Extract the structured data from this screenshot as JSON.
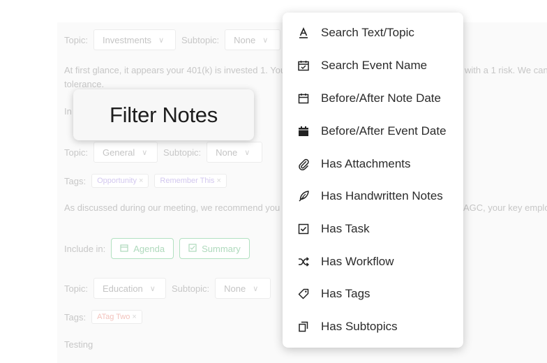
{
  "background": {
    "note1": {
      "topic_label": "Topic:",
      "topic_value": "Investments",
      "subtopic_label": "Subtopic:",
      "subtopic_value": "None",
      "body_line1_left": "At first glance, it appears your 401(k) is invested 1. You h",
      "body_line1_right": "with a 1 risk. We can",
      "body_line2": "tolerance.",
      "include_fragment": "In"
    },
    "note2": {
      "topic_label": "Topic:",
      "topic_value": "General",
      "subtopic_label": "Subtopic:",
      "subtopic_value": "None",
      "tags_label": "Tags:",
      "tags": [
        "Opportunity",
        "Remember This"
      ],
      "body_left": "As discussed during our meeting, we recommend you co",
      "body_right": "AGC, your key employ",
      "include_label": "Include in:",
      "include_chips": [
        "Agenda",
        "Summary"
      ]
    },
    "note3": {
      "topic_label": "Topic:",
      "topic_value": "Education",
      "subtopic_label": "Subtopic:",
      "subtopic_value": "None",
      "tags_label": "Tags:",
      "tags": [
        "ATag Two"
      ],
      "body": "Testing"
    },
    "tag_close_glyph": "×",
    "chevron_glyph": "∨"
  },
  "filter_title": "Filter Notes",
  "menu": {
    "items": [
      {
        "label": "Search Text/Topic",
        "icon": "text-a-icon"
      },
      {
        "label": "Search Event Name",
        "icon": "calendar-check-icon"
      },
      {
        "label": "Before/After Note Date",
        "icon": "calendar-outline-icon"
      },
      {
        "label": "Before/After Event Date",
        "icon": "calendar-filled-icon"
      },
      {
        "label": "Has Attachments",
        "icon": "paperclip-icon"
      },
      {
        "label": "Has Handwritten Notes",
        "icon": "quill-icon"
      },
      {
        "label": "Has Task",
        "icon": "checkbox-icon"
      },
      {
        "label": "Has Workflow",
        "icon": "shuffle-icon"
      },
      {
        "label": "Has Tags",
        "icon": "tag-icon"
      },
      {
        "label": "Has Subtopics",
        "icon": "copy-pages-icon"
      }
    ]
  },
  "colors": {
    "accent_green": "#38b25e",
    "tag_purple": "#8b6fd6",
    "tag_red": "#e06050",
    "menu_text": "#2b2b2b"
  }
}
